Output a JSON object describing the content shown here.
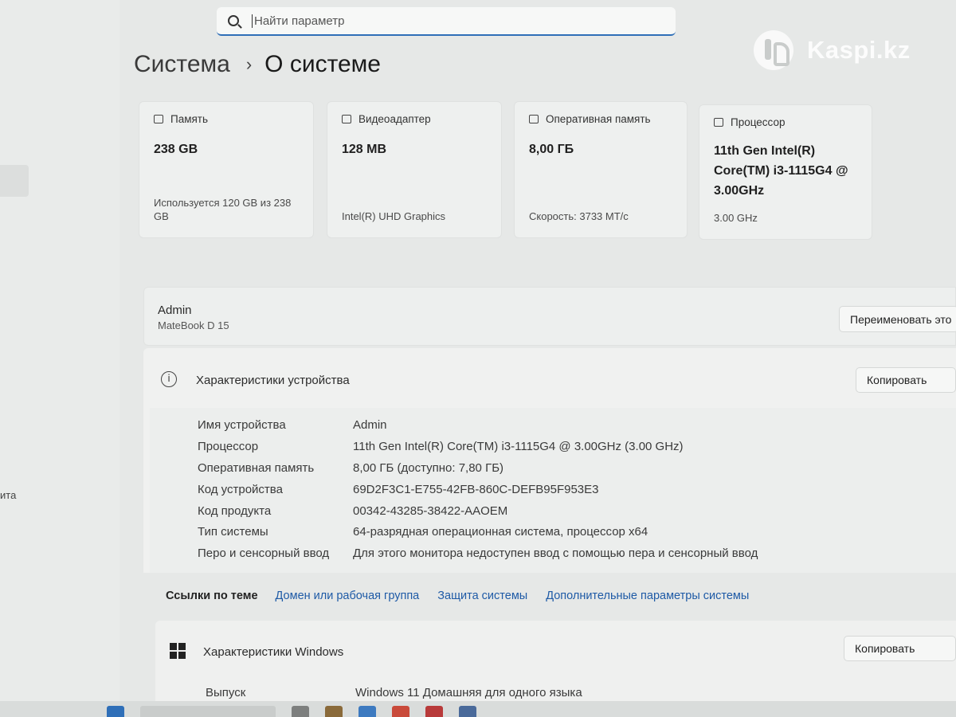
{
  "search": {
    "placeholder": "Найти параметр",
    "value": ""
  },
  "watermark": "Kaspi.kz",
  "left_cut_text": "ита",
  "breadcrumb": {
    "root": "Система",
    "separator": "›",
    "current": "О системе"
  },
  "cards": [
    {
      "icon": "storage-icon",
      "label": "Память",
      "value": "238 GB",
      "sub": "Используется 120 GB из 238 GB"
    },
    {
      "icon": "display-adapter-icon",
      "label": "Видеоадаптер",
      "value": "128 MB",
      "sub": "Intel(R) UHD Graphics"
    },
    {
      "icon": "ram-icon",
      "label": "Оперативная память",
      "value": "8,00 ГБ",
      "sub": "Скорость: 3733 MT/c"
    },
    {
      "icon": "cpu-icon",
      "label": "Процессор",
      "value": "11th Gen Intel(R) Core(TM) i3-1115G4 @ 3.00GHz",
      "sub": "3.00 GHz"
    }
  ],
  "device": {
    "name": "Admin",
    "model": "MateBook D 15",
    "rename_button": "Переименовать это"
  },
  "specs": {
    "title": "Характеристики устройства",
    "copy_button": "Копировать",
    "rows": [
      {
        "label": "Имя устройства",
        "value": "Admin"
      },
      {
        "label": "Процессор",
        "value": "11th Gen Intel(R) Core(TM) i3-1115G4 @ 3.00GHz (3.00 GHz)"
      },
      {
        "label": "Оперативная память",
        "value": "8,00 ГБ (доступно: 7,80 ГБ)"
      },
      {
        "label": "Код устройства",
        "value": "69D2F3C1-E755-42FB-860C-DEFB95F953E3"
      },
      {
        "label": "Код продукта",
        "value": "00342-43285-38422-AAOEM"
      },
      {
        "label": "Тип системы",
        "value": "64-разрядная операционная система, процессор x64"
      },
      {
        "label": "Перо и сенсорный ввод",
        "value": "Для этого монитора недоступен ввод с помощью пера и сенсорный ввод"
      }
    ]
  },
  "related": {
    "label": "Ссылки по теме",
    "links": [
      "Домен или рабочая группа",
      "Защита системы",
      "Дополнительные параметры системы"
    ]
  },
  "windows": {
    "title": "Характеристики Windows",
    "copy_button": "Копировать",
    "edition_label": "Выпуск",
    "edition_value": "Windows 11 Домашняя для одного языка"
  },
  "colors": {
    "accent": "#2f6fb8",
    "link": "#1e5aa6"
  }
}
